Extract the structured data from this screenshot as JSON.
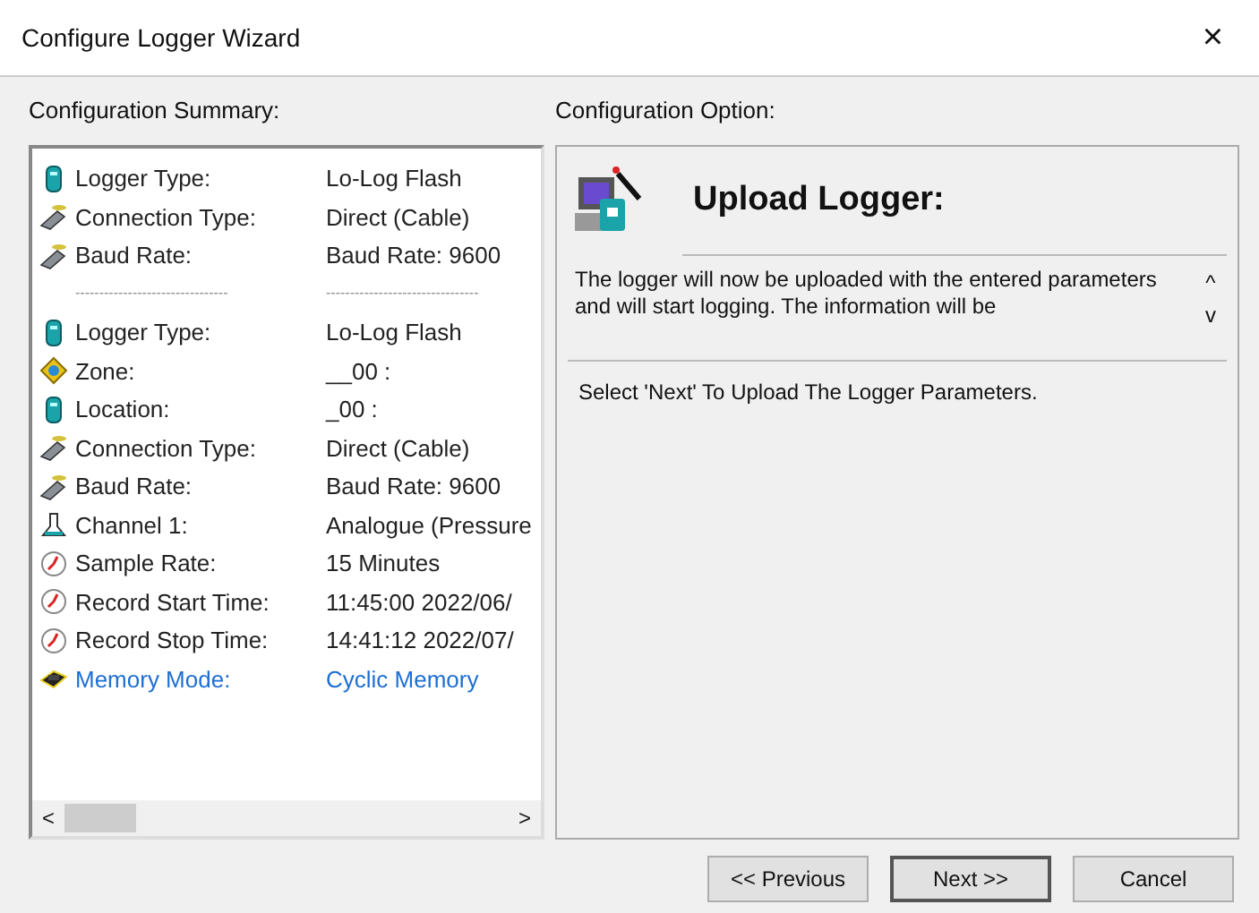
{
  "window": {
    "title": "Configure Logger Wizard",
    "close": "×"
  },
  "summary": {
    "heading": "Configuration Summary:",
    "rows": [
      {
        "kind": "logger",
        "label": "Logger Type:",
        "value": "Lo-Log Flash",
        "highlighted": false
      },
      {
        "kind": "cable",
        "label": "Connection Type:",
        "value": "Direct (Cable)",
        "highlighted": false
      },
      {
        "kind": "cable",
        "label": "Baud Rate:",
        "value": "Baud Rate: 9600",
        "highlighted": false
      },
      {
        "kind": "separator",
        "label": "--------------------------------",
        "value": "--------------------------------",
        "highlighted": false
      },
      {
        "kind": "logger",
        "label": "Logger Type:",
        "value": "Lo-Log Flash",
        "highlighted": false
      },
      {
        "kind": "zone",
        "label": "Zone:",
        "value": "__00 :",
        "highlighted": false
      },
      {
        "kind": "logger",
        "label": "Location:",
        "value": "_00 :",
        "highlighted": false
      },
      {
        "kind": "cable",
        "label": "Connection Type:",
        "value": "Direct (Cable)",
        "highlighted": false
      },
      {
        "kind": "cable",
        "label": "Baud Rate:",
        "value": "Baud Rate: 9600",
        "highlighted": false
      },
      {
        "kind": "channel",
        "label": "Channel 1:",
        "value": "Analogue (Pressure",
        "highlighted": false
      },
      {
        "kind": "clock",
        "label": "Sample Rate:",
        "value": "15 Minutes",
        "highlighted": false
      },
      {
        "kind": "clock",
        "label": "Record Start Time:",
        "value": "11:45:00 2022/06/",
        "highlighted": false
      },
      {
        "kind": "clock",
        "label": "Record Stop Time:",
        "value": "14:41:12 2022/07/",
        "highlighted": false
      },
      {
        "kind": "memory",
        "label": "Memory Mode:",
        "value": "Cyclic Memory",
        "highlighted": true
      }
    ],
    "scroll_left": "<",
    "scroll_right": ">"
  },
  "option": {
    "heading": "Configuration Option:",
    "title": "Upload Logger:",
    "description": "The logger will now be uploaded with the entered parameters and will start logging. The information will be",
    "scroll_up": "^",
    "scroll_down": "v",
    "instruction": "Select 'Next' To Upload The Logger Parameters."
  },
  "buttons": [
    {
      "label": "<< Previous",
      "default": false
    },
    {
      "label": "Next >>",
      "default": true
    },
    {
      "label": "Cancel",
      "default": false
    }
  ]
}
